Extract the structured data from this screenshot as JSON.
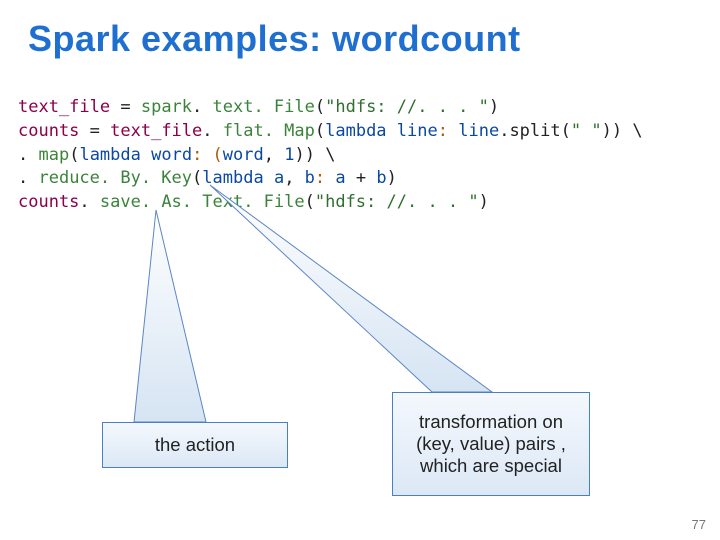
{
  "title": "Spark examples: wordcount",
  "code": {
    "l1_text_file": "text_file",
    "l1_eq": " = ",
    "l1_spark": "spark",
    "l1_dot1": ". ",
    "l1_textFile": "text. File",
    "l1_paren_open": "(",
    "l1_str": "\"hdfs: //. . . \"",
    "l1_paren_close": ")",
    "l2_counts": "counts",
    "l2_eq": " = ",
    "l2_text_file": "text_file",
    "l2_dot": ". ",
    "l2_flatmap": "flat. Map",
    "l2_paren_open": "(",
    "l2_lambda": "lambda",
    "l2_sp1": " ",
    "l2_line": "line",
    "l2_colon": ": ",
    "l2_line2": "line",
    "l2_dot2": ".",
    "l2_split": "split",
    "l2_po2": "(",
    "l2_str": "\" \"",
    "l2_pc2": "))",
    "l2_bs": " \\",
    "l3_indent": "        . ",
    "l3_map": "map",
    "l3_po": "(",
    "l3_lambda": "lambda",
    "l3_sp": " ",
    "l3_word": "word",
    "l3_colon": ": (",
    "l3_word2": "word",
    "l3_comma": ", ",
    "l3_one": "1",
    "l3_pc": "))",
    "l3_bs": " \\",
    "l4_indent": "        . ",
    "l4_reduce": "reduce. By. Key",
    "l4_po": "(",
    "l4_lambda": "lambda",
    "l4_sp": " ",
    "l4_a": "a",
    "l4_comma": ", ",
    "l4_b": "b",
    "l4_colon": ": ",
    "l4_a2": "a",
    "l4_plus": " + ",
    "l4_b2": "b",
    "l4_pc": ")",
    "l5_counts": "counts",
    "l5_dot": ". ",
    "l5_save": "save. As. Text. File",
    "l5_po": "(",
    "l5_str": "\"hdfs: //. . . \"",
    "l5_pc": ")"
  },
  "callouts": {
    "action": "the action",
    "transformation": "transformation on (key, value) pairs , which are special"
  },
  "page_number": "77"
}
